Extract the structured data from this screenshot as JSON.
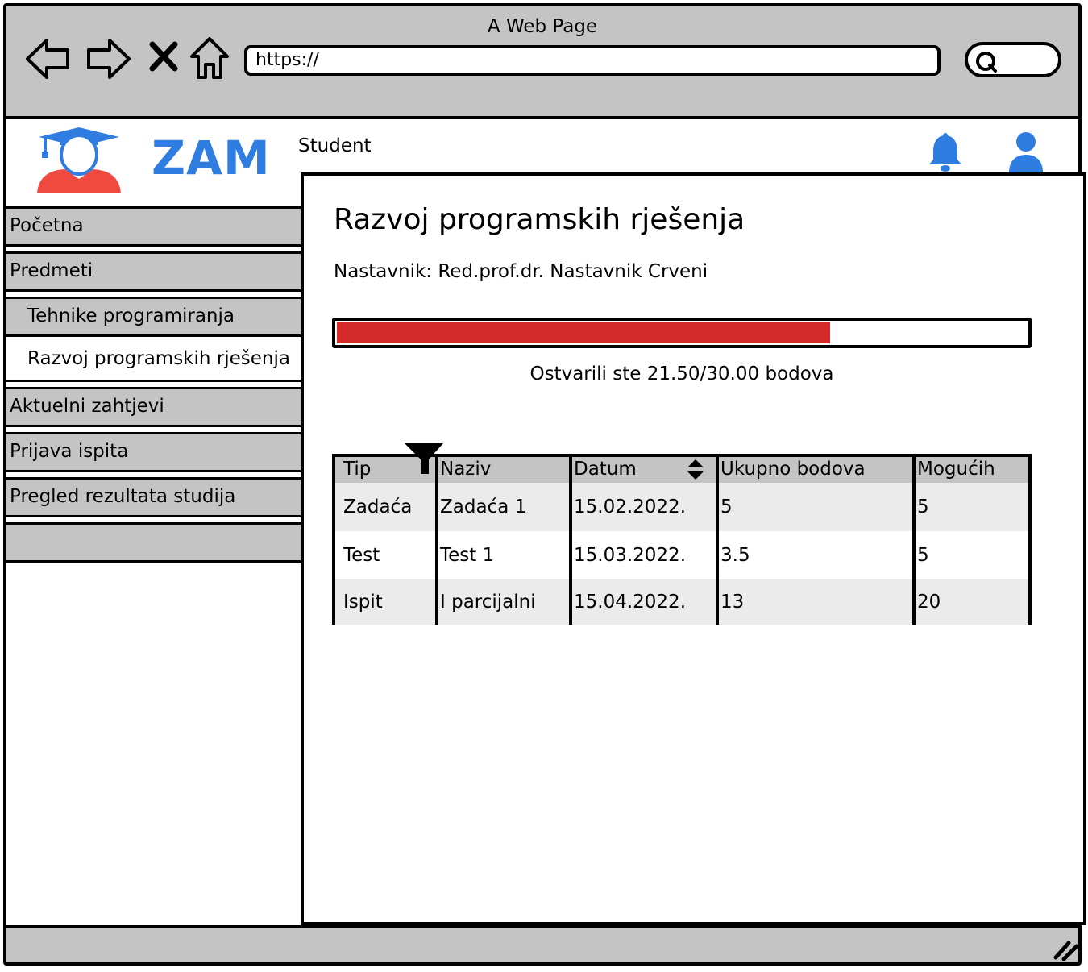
{
  "browser": {
    "window_title": "A Web Page",
    "url": "https://"
  },
  "app": {
    "brand": "ZAM",
    "role": "Student",
    "brand_color": "#2f7de1",
    "accent_red": "#d42a2a"
  },
  "sidebar": {
    "items": [
      {
        "label": "Početna"
      },
      {
        "label": "Predmeti"
      },
      {
        "label": "Tehnike programiranja"
      },
      {
        "label": "Razvoj programskih rješenja",
        "active": true
      },
      {
        "label": "Aktuelni zahtjevi"
      },
      {
        "label": "Prijava ispita"
      },
      {
        "label": "Pregled rezultata studija"
      },
      {
        "label": ""
      }
    ]
  },
  "main": {
    "title": "Razvoj programskih rješenja",
    "teacher": "Nastavnik: Red.prof.dr. Nastavnik Crveni",
    "progress_fraction": 0.7167,
    "progress_text": "Ostvarili ste 21.50/30.00 bodova",
    "table": {
      "headers": [
        "Tip",
        "Naziv",
        "Datum",
        "Ukupno bodova",
        "Mogućih"
      ],
      "rows": [
        [
          "Zadaća",
          "Zadaća 1",
          "15.02.2022.",
          "5",
          "5"
        ],
        [
          "Test",
          "Test 1",
          "15.03.2022.",
          "3.5",
          "5"
        ],
        [
          "Ispit",
          "I parcijalni",
          "15.04.2022.",
          "13",
          "20"
        ]
      ]
    }
  }
}
